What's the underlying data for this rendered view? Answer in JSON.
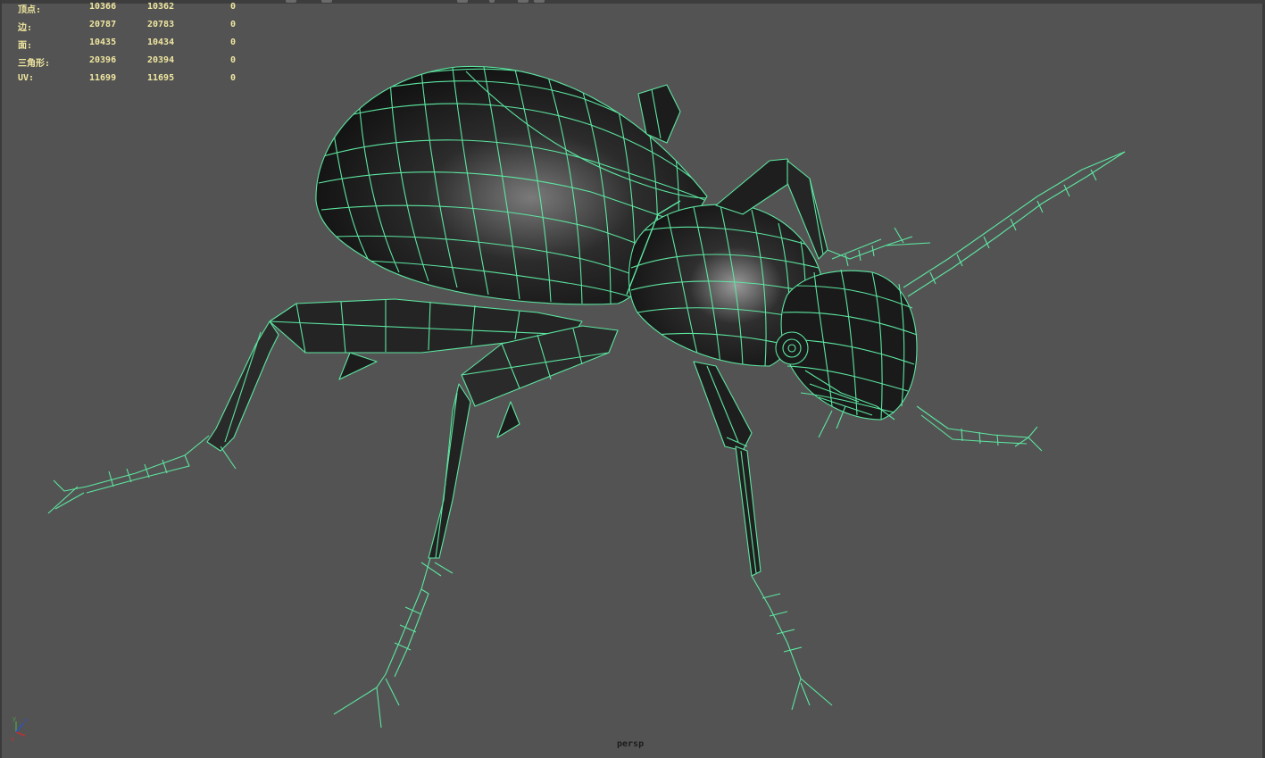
{
  "viewport": {
    "camera": "persp",
    "background_color": "#535353",
    "wireframe_color": "#5ce6a0"
  },
  "hud": {
    "rows": [
      {
        "label": "顶点:",
        "values": [
          "10366",
          "10362",
          "0"
        ]
      },
      {
        "label": "边:",
        "values": [
          "20787",
          "20783",
          "0"
        ]
      },
      {
        "label": "面:",
        "values": [
          "10435",
          "10434",
          "0"
        ]
      },
      {
        "label": "三角形:",
        "values": [
          "20396",
          "20394",
          "0"
        ]
      },
      {
        "label": "UV:",
        "values": [
          "11699",
          "11695",
          "0"
        ]
      }
    ]
  },
  "axis_gizmo": {
    "x": "x",
    "y": "y",
    "z": "z"
  }
}
